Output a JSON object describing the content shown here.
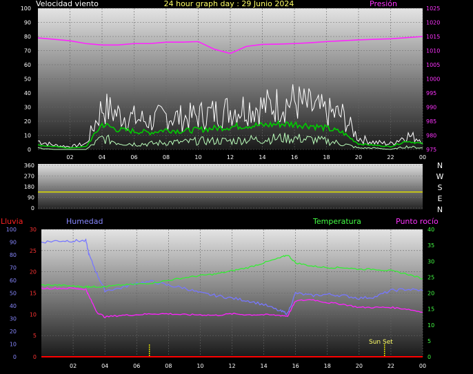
{
  "header": {
    "wind_label": "Velocidad viento",
    "title": "24 hour graph day : 29 Junio 2024",
    "pressure_label": "Presión"
  },
  "colors": {
    "wind": "#ffffff",
    "wind_avg": "#00cc00",
    "wind_min": "#bbffbb",
    "pressure": "#ff22ff",
    "direction": "#dddd00",
    "rain": "#ff0000",
    "humidity": "#7777ff",
    "temperature": "#33ee33",
    "dewpoint": "#ff22ff",
    "sunset": "#dddd00"
  },
  "time_ticks": [
    "02",
    "04",
    "06",
    "08",
    "10",
    "12",
    "14",
    "16",
    "18",
    "20",
    "22",
    "00"
  ],
  "compass": [
    "N",
    "W",
    "S",
    "E",
    "N"
  ],
  "bottom_labels": {
    "rain": "Lluvia",
    "humidity": "Humedad",
    "temperature": "Temperatura",
    "dewpoint": "Punto rocío",
    "sunset": "Sun Set"
  },
  "chart_data": [
    {
      "type": "line",
      "name": "wind-pressure",
      "x_hours": [
        0,
        1,
        2,
        3,
        4,
        5,
        6,
        7,
        8,
        9,
        10,
        11,
        12,
        13,
        14,
        15,
        16,
        17,
        18,
        19,
        20,
        21,
        22,
        23,
        24
      ],
      "y_left_ticks": [
        0,
        10,
        20,
        30,
        40,
        50,
        60,
        70,
        80,
        90,
        100
      ],
      "y_right_ticks": [
        975,
        980,
        985,
        990,
        995,
        1000,
        1005,
        1010,
        1015,
        1020,
        1025
      ],
      "ylim_left": [
        0,
        100
      ],
      "ylim_right": [
        975,
        1025
      ],
      "series": [
        {
          "key": "gust",
          "values": [
            6,
            3,
            2,
            4,
            30,
            25,
            22,
            20,
            24,
            22,
            24,
            26,
            28,
            30,
            30,
            32,
            34,
            30,
            26,
            24,
            8,
            5,
            4,
            10,
            7
          ]
        },
        {
          "key": "avg",
          "values": [
            3,
            2,
            1,
            2,
            18,
            14,
            13,
            12,
            14,
            13,
            14,
            15,
            16,
            17,
            17,
            18,
            18,
            17,
            15,
            12,
            4,
            3,
            2,
            6,
            4
          ]
        },
        {
          "key": "min",
          "values": [
            1,
            0,
            0,
            0,
            8,
            5,
            4,
            4,
            5,
            5,
            6,
            6,
            6,
            7,
            7,
            8,
            8,
            7,
            6,
            4,
            1,
            1,
            0,
            2,
            1
          ]
        },
        {
          "key": "pressure",
          "values": [
            1014.5,
            1014,
            1013.5,
            1012.5,
            1012,
            1012,
            1012.5,
            1012.5,
            1013,
            1013,
            1013.2,
            1010.5,
            1009,
            1011.5,
            1012.2,
            1012.3,
            1012.5,
            1012.8,
            1013.2,
            1013.5,
            1013.8,
            1014,
            1014.2,
            1014.6,
            1015
          ]
        }
      ]
    },
    {
      "type": "line",
      "name": "wind-direction",
      "y_ticks": [
        0,
        90,
        180,
        270,
        360
      ],
      "ylim": [
        0,
        360
      ],
      "series": [
        {
          "key": "direction",
          "values": [
            135,
            135,
            135,
            135,
            135,
            135,
            135,
            135,
            135,
            135,
            135,
            135,
            135,
            135,
            135,
            135,
            135,
            135,
            135,
            135,
            135,
            135,
            135,
            135,
            135
          ]
        }
      ]
    },
    {
      "type": "line",
      "name": "temp-humidity",
      "x_hours": [
        0,
        1,
        2,
        2.8,
        3,
        3.5,
        4,
        5,
        6,
        7,
        8,
        9,
        10,
        11,
        12,
        13,
        14,
        15,
        15.5,
        16,
        17,
        18,
        19,
        20,
        21,
        22,
        23,
        24
      ],
      "y_rain_ticks": [
        0,
        5,
        10,
        15,
        20,
        25,
        30
      ],
      "y_hum_ticks": [
        0,
        10,
        20,
        30,
        40,
        50,
        60,
        70,
        80,
        90,
        100
      ],
      "y_temp_ticks": [
        0,
        5,
        10,
        15,
        20,
        25,
        30,
        35,
        40
      ],
      "ylim_rain": [
        0,
        30
      ],
      "ylim_hum": [
        0,
        100
      ],
      "ylim_temp": [
        0,
        40
      ],
      "series": [
        {
          "key": "humidity",
          "values": [
            90,
            91,
            91,
            91,
            80,
            65,
            52,
            54,
            58,
            59,
            56,
            54,
            50,
            48,
            46,
            44,
            41,
            36,
            34,
            50,
            48,
            49,
            48,
            46,
            47,
            52,
            53,
            52
          ]
        },
        {
          "key": "temperature",
          "values": [
            22.5,
            22.5,
            22.2,
            22,
            22,
            22,
            22,
            22.5,
            22.8,
            23.2,
            24,
            24.8,
            25.5,
            26,
            27,
            28,
            29.5,
            31,
            32,
            29.5,
            28.5,
            28,
            28,
            27.5,
            27.5,
            27,
            26,
            24.5
          ]
        },
        {
          "key": "dewpoint",
          "values": [
            21.5,
            21.5,
            21.5,
            21.2,
            19,
            14,
            12.5,
            13,
            13.2,
            13.5,
            13.5,
            13.2,
            13.2,
            13,
            13.5,
            13.2,
            13.2,
            13,
            12.8,
            17.5,
            18,
            17,
            16.5,
            15.5,
            15.5,
            15.5,
            15,
            14
          ]
        },
        {
          "key": "rain",
          "values": [
            0,
            0,
            0,
            0,
            0,
            0,
            0,
            0,
            0,
            0,
            0,
            0,
            0,
            0,
            0,
            0,
            0,
            0,
            0,
            0,
            0,
            0,
            0,
            0,
            0,
            0,
            0,
            0
          ]
        }
      ]
    }
  ]
}
